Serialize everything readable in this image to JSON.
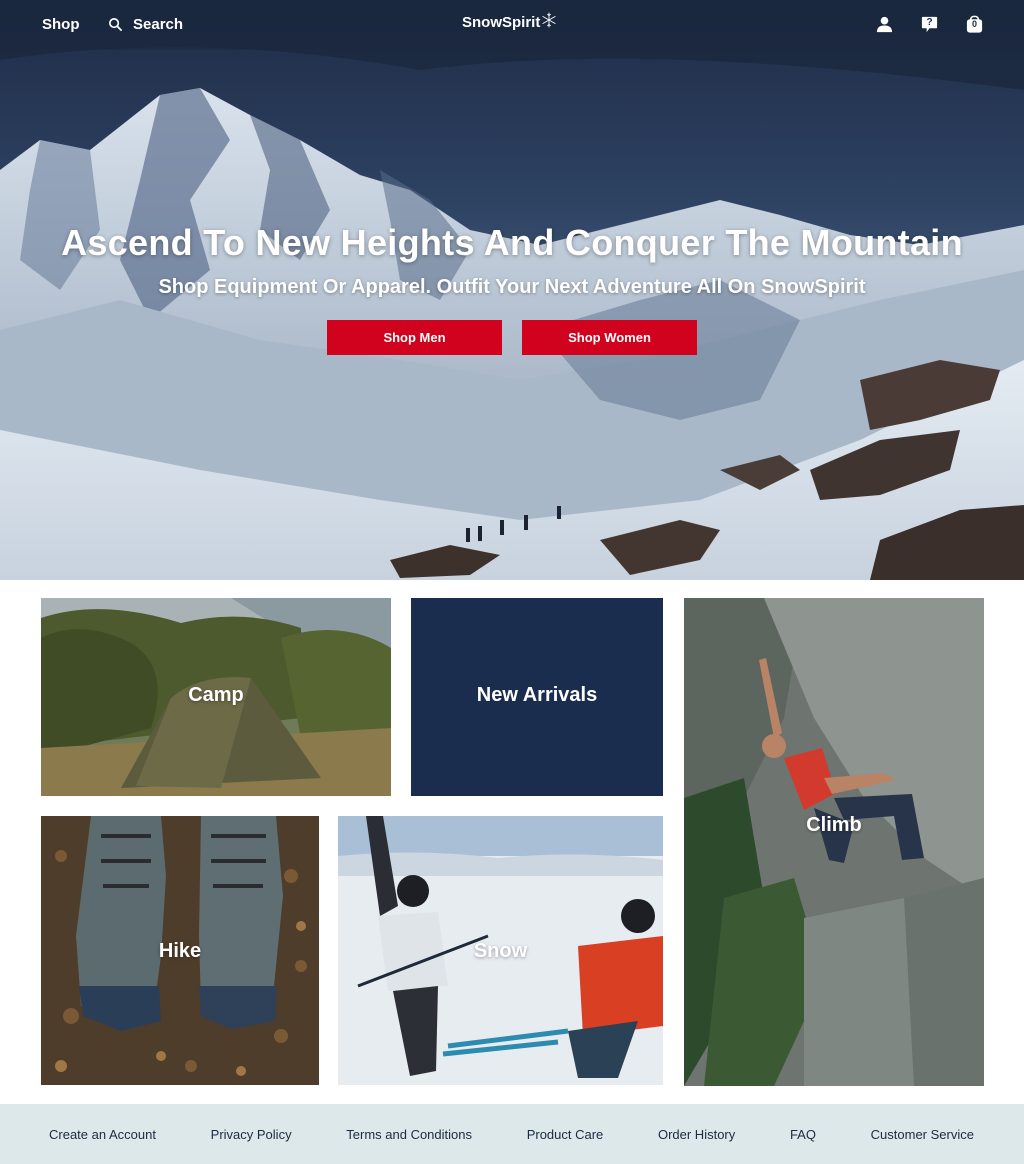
{
  "nav": {
    "shop_label": "Shop",
    "search_label": "Search",
    "logo_text": "SnowSpirit",
    "cart_count": "0",
    "help_mark": "?",
    "icons": [
      "account-icon",
      "help-icon",
      "cart-icon",
      "search-icon",
      "snowflake-icon"
    ]
  },
  "hero": {
    "title": "Ascend To New Heights And Conquer The Mountain",
    "subtitle": "Shop Equipment Or Apparel. Outfit Your Next Adventure All On SnowSpirit",
    "buttons": {
      "men": "Shop Men",
      "women": "Shop Women"
    },
    "button_color": "#d1021d"
  },
  "categories": {
    "camp": "Camp",
    "new_arrivals": "New Arrivals",
    "climb": "Climb",
    "hike": "Hike",
    "snow": "Snow",
    "new_arrivals_bg": "#1b2d4f"
  },
  "footer": {
    "links": [
      "Create an Account",
      "Privacy Policy",
      "Terms and Conditions",
      "Product Care",
      "Order History",
      "FAQ",
      "Customer Service"
    ],
    "bg": "#dde8ea"
  }
}
